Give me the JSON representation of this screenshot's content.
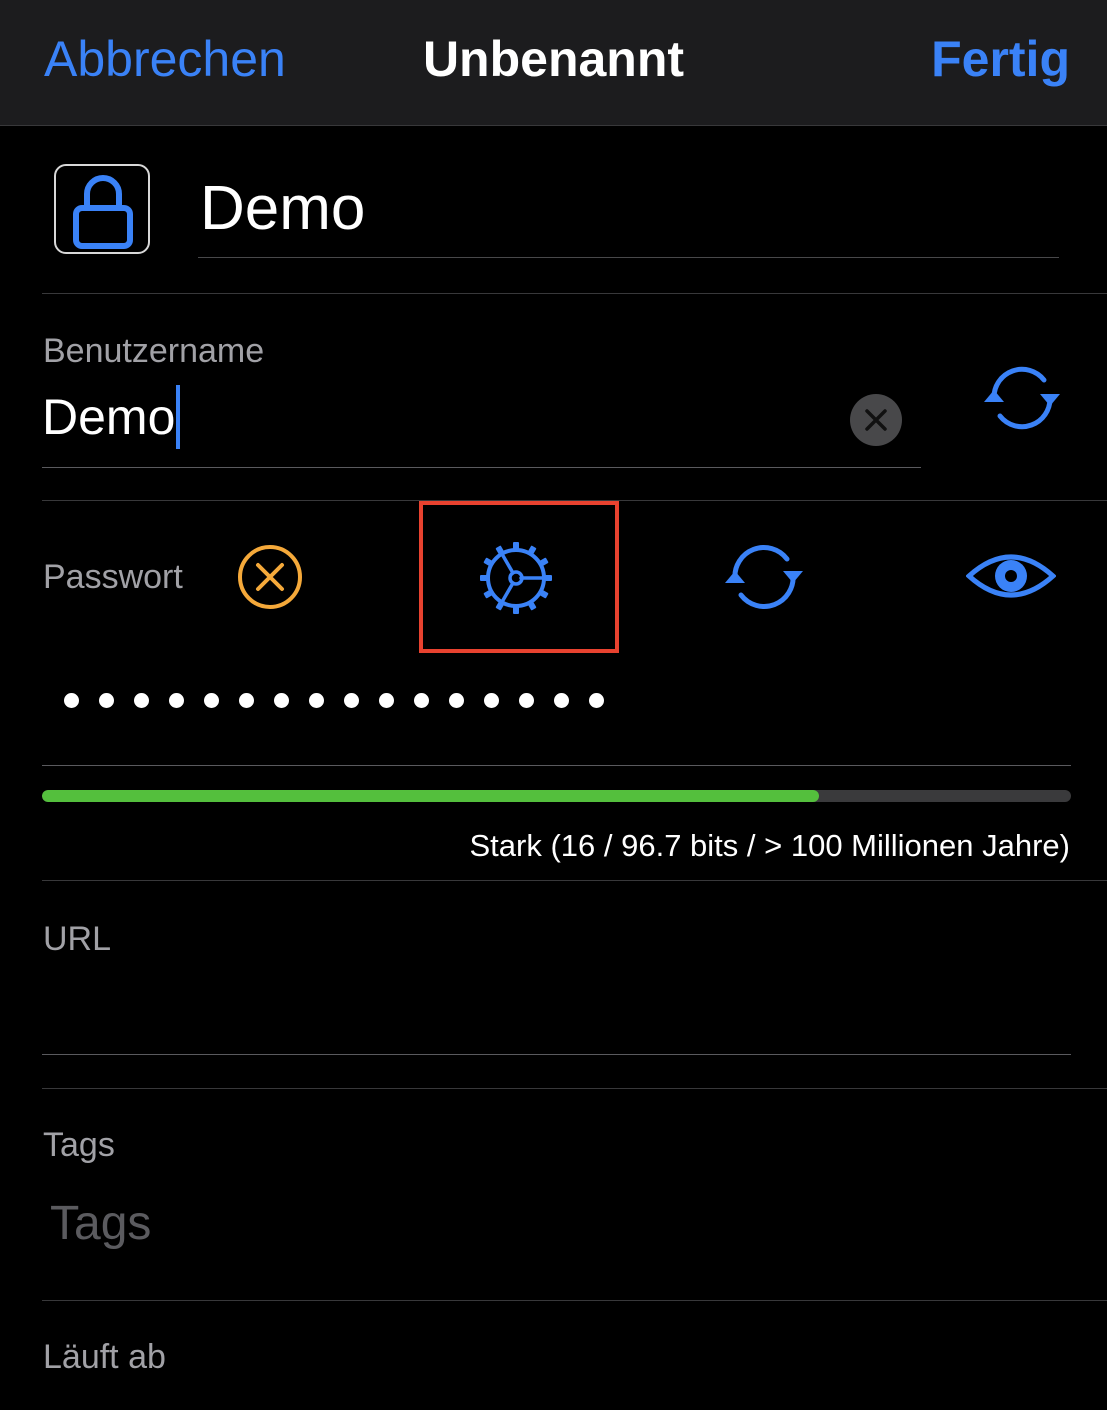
{
  "navbar": {
    "cancel_label": "Abbrechen",
    "title": "Unbenannt",
    "done_label": "Fertig"
  },
  "entry": {
    "icon": "lock-icon",
    "title_value": "Demo"
  },
  "username": {
    "label": "Benutzername",
    "value": "Demo"
  },
  "password": {
    "label": "Passwort",
    "masked_length": 16,
    "actions": [
      "clear-x-icon",
      "gear-icon",
      "refresh-icon",
      "eye-icon"
    ],
    "strength_fraction": 0.755,
    "strength_text": "Stark (16 / 96.7 bits / > 100 Millionen Jahre)"
  },
  "url": {
    "label": "URL",
    "value": ""
  },
  "tags": {
    "label": "Tags",
    "placeholder": "Tags"
  },
  "expiry": {
    "label": "Läuft ab"
  },
  "colors": {
    "accent": "#3a82f7",
    "warning": "#f5a93a",
    "highlight_box": "#e8422f",
    "strength_good": "#54bf3d"
  }
}
